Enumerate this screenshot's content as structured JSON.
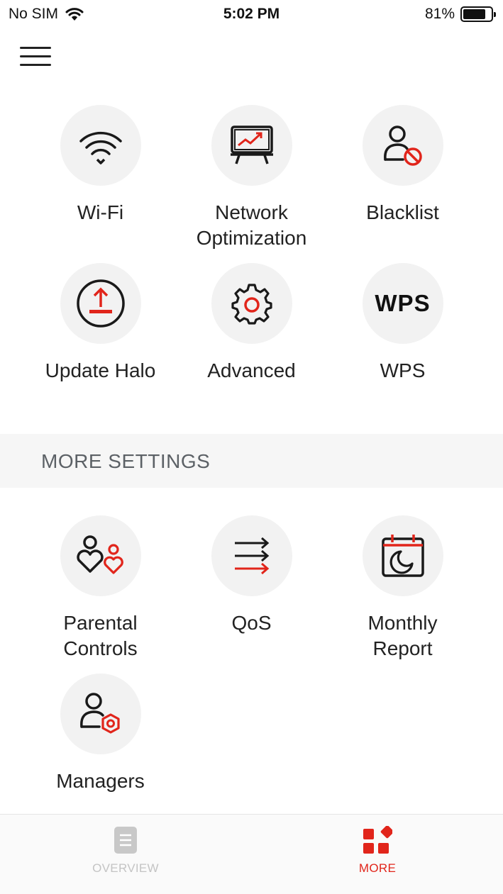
{
  "status": {
    "carrier": "No SIM",
    "time": "5:02 PM",
    "battery": "81%",
    "battery_level": 0.81
  },
  "menu_items": [
    {
      "label": "Wi-Fi",
      "icon": "wifi-icon"
    },
    {
      "label": "Network\nOptimization",
      "icon": "network-optimization-icon"
    },
    {
      "label": "Blacklist",
      "icon": "blacklist-icon"
    },
    {
      "label": "Update Halo",
      "icon": "update-halo-icon"
    },
    {
      "label": "Advanced",
      "icon": "gear-icon"
    },
    {
      "label": "WPS",
      "icon_text": "WPS"
    }
  ],
  "more_settings": {
    "title": "MORE SETTINGS",
    "items": [
      {
        "label": "Parental\nControls",
        "icon": "parental-controls-icon"
      },
      {
        "label": "QoS",
        "icon": "qos-icon"
      },
      {
        "label": "Monthly\nReport",
        "icon": "monthly-report-icon"
      },
      {
        "label": "Managers",
        "icon": "managers-icon"
      }
    ]
  },
  "tabs": [
    {
      "label": "OVERVIEW",
      "icon": "overview-icon",
      "active": false
    },
    {
      "label": "MORE",
      "icon": "more-icon",
      "active": true
    }
  ],
  "colors": {
    "accent": "#e1251b",
    "inactive": "#c4c4c4",
    "text": "#222222"
  }
}
